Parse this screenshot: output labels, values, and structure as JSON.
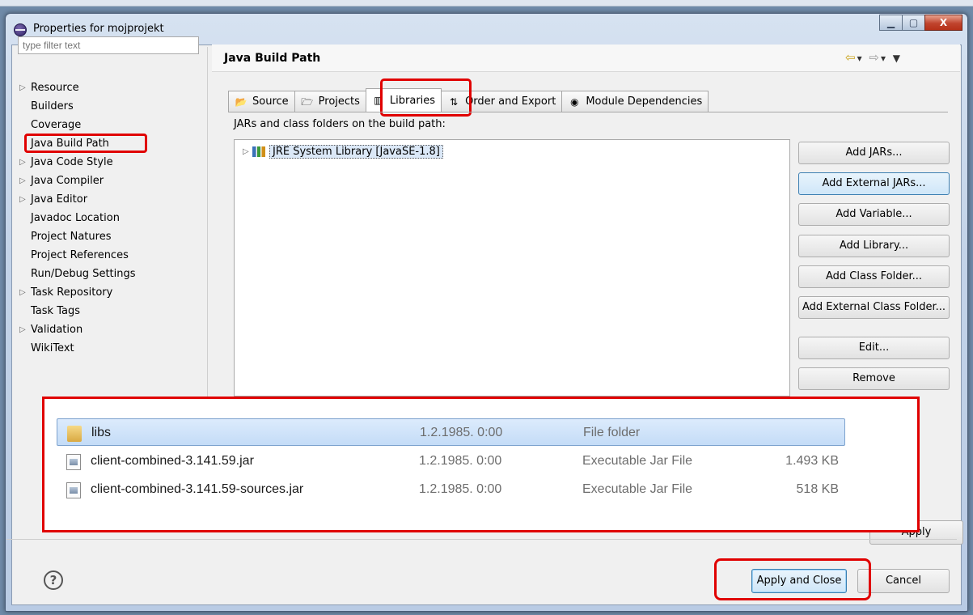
{
  "window": {
    "title": "Properties for mojprojekt",
    "controls": {
      "minimize": "▁",
      "maximize": "▢",
      "close": "X"
    }
  },
  "sidebar": {
    "filter_placeholder": "type filter text",
    "items": [
      {
        "label": "Resource",
        "expandable": true
      },
      {
        "label": "Builders",
        "expandable": false
      },
      {
        "label": "Coverage",
        "expandable": false
      },
      {
        "label": "Java Build Path",
        "expandable": false,
        "selected": true
      },
      {
        "label": "Java Code Style",
        "expandable": true
      },
      {
        "label": "Java Compiler",
        "expandable": true
      },
      {
        "label": "Java Editor",
        "expandable": true
      },
      {
        "label": "Javadoc Location",
        "expandable": false
      },
      {
        "label": "Project Natures",
        "expandable": false
      },
      {
        "label": "Project References",
        "expandable": false
      },
      {
        "label": "Run/Debug Settings",
        "expandable": false
      },
      {
        "label": "Task Repository",
        "expandable": true
      },
      {
        "label": "Task Tags",
        "expandable": false
      },
      {
        "label": "Validation",
        "expandable": true
      },
      {
        "label": "WikiText",
        "expandable": false
      }
    ]
  },
  "main": {
    "title": "Java Build Path",
    "tabs": [
      {
        "label": "Source",
        "icon": "source-folder-icon"
      },
      {
        "label": "Projects",
        "icon": "projects-folder-icon"
      },
      {
        "label": "Libraries",
        "icon": "libraries-icon",
        "active": true
      },
      {
        "label": "Order and Export",
        "icon": "order-export-icon"
      },
      {
        "label": "Module Dependencies",
        "icon": "module-icon"
      }
    ],
    "jars_label": "JARs and class folders on the build path:",
    "library": {
      "name": "JRE System Library [JavaSE-1.8]"
    },
    "buttons": [
      {
        "label": "Add JARs..."
      },
      {
        "label": "Add External JARs...",
        "hot": true
      },
      {
        "label": "Add Variable..."
      },
      {
        "label": "Add Library..."
      },
      {
        "label": "Add Class Folder..."
      },
      {
        "label": "Add External Class Folder..."
      },
      {
        "label": "Edit..."
      },
      {
        "label": "Remove"
      }
    ],
    "apply_label": "Apply"
  },
  "footer": {
    "help_label": "?",
    "apply_close_label": "Apply and Close",
    "cancel_label": "Cancel"
  },
  "file_overlay": {
    "files": [
      {
        "name": "libs",
        "date": "1.2.1985. 0:00",
        "type": "File folder",
        "size": "",
        "icon": "folder-icon"
      },
      {
        "name": "client-combined-3.141.59.jar",
        "date": "1.2.1985. 0:00",
        "type": "Executable Jar File",
        "size": "1.493 KB",
        "icon": "jar-file-icon"
      },
      {
        "name": "client-combined-3.141.59-sources.jar",
        "date": "1.2.1985. 0:00",
        "type": "Executable Jar File",
        "size": "518 KB",
        "icon": "jar-file-icon"
      }
    ]
  },
  "colors": {
    "highlight": "#e00000",
    "accent": "#3c7fb1"
  }
}
